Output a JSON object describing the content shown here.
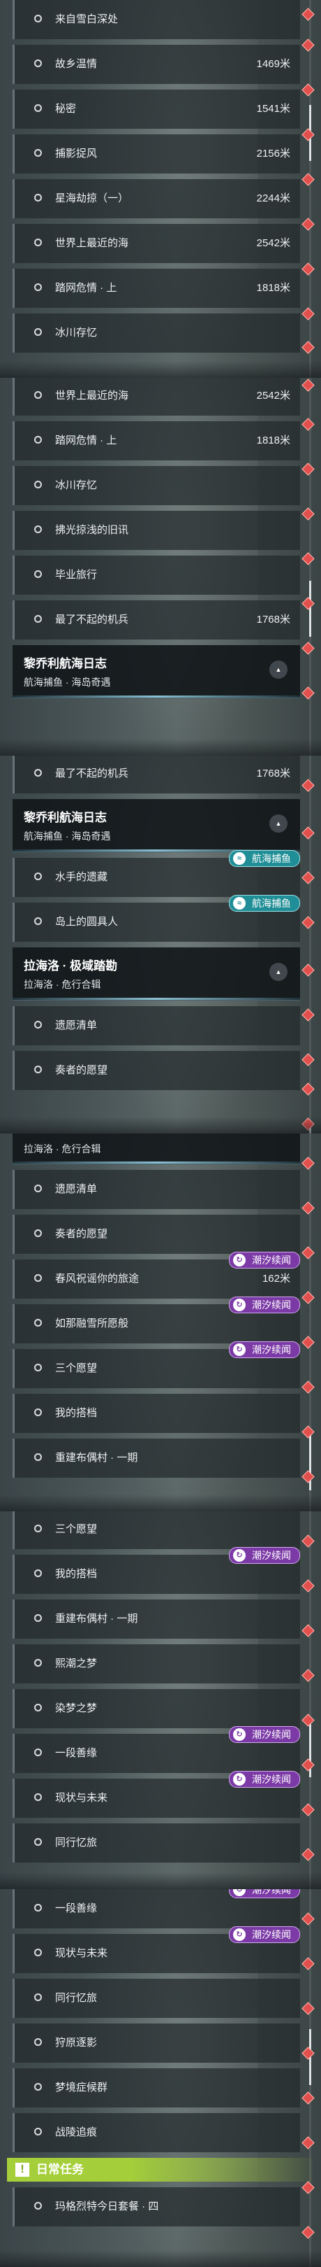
{
  "tags": {
    "chaoxi": "潮汐续闻",
    "hanghai": "航海捕鱼",
    "chaoxi_icon": "spiral-icon",
    "hanghai_icon": "fish-icon"
  },
  "colors": {
    "daily_header": "#a5cf3a",
    "purple_tag": "#7b3aa6",
    "teal_tag": "#1f8e96",
    "marker": "#e2504e"
  },
  "frames": [
    {
      "items": [
        {
          "type": "row",
          "name": "来自雪白深处",
          "dist": ""
        },
        {
          "type": "row",
          "name": "故乡温情",
          "dist": "1469米"
        },
        {
          "type": "row",
          "name": "秘密",
          "dist": "1541米"
        },
        {
          "type": "row",
          "name": "捕影捉风",
          "dist": "2156米"
        },
        {
          "type": "row",
          "name": "星海劫掠（一）",
          "dist": "2244米"
        },
        {
          "type": "row",
          "name": "世界上最近的海",
          "dist": "2542米"
        },
        {
          "type": "row",
          "name": "踏网危情 · 上",
          "dist": "1818米"
        },
        {
          "type": "row",
          "name": "冰川存忆",
          "dist": ""
        }
      ]
    },
    {
      "items": [
        {
          "type": "row",
          "name": "世界上最近的海",
          "dist": "2542米"
        },
        {
          "type": "row",
          "name": "踏网危情 · 上",
          "dist": "1818米"
        },
        {
          "type": "row",
          "name": "冰川存忆",
          "dist": ""
        },
        {
          "type": "row",
          "name": "拂光掠浅的旧讯",
          "dist": ""
        },
        {
          "type": "row",
          "name": "毕业旅行",
          "dist": ""
        },
        {
          "type": "row",
          "name": "最了不起的机兵",
          "dist": "1768米"
        },
        {
          "type": "header",
          "title": "黎乔利航海日志",
          "sub": "航海捕鱼 · 海岛奇遇"
        }
      ]
    },
    {
      "items": [
        {
          "type": "row",
          "name": "最了不起的机兵",
          "dist": "1768米"
        },
        {
          "type": "header",
          "title": "黎乔利航海日志",
          "sub": "航海捕鱼 · 海岛奇遇"
        },
        {
          "type": "row",
          "name": "水手的遗藏",
          "dist": "",
          "tag": "hanghai"
        },
        {
          "type": "row",
          "name": "岛上的圆具人",
          "dist": "",
          "tag": "hanghai"
        },
        {
          "type": "header",
          "title": "拉海洛 · 极域踏勘",
          "sub": "拉海洛 · 危行合辑"
        },
        {
          "type": "row",
          "name": "遗愿清单",
          "dist": ""
        },
        {
          "type": "row",
          "name": "奏者的愿望",
          "dist": ""
        }
      ]
    },
    {
      "items": [
        {
          "type": "header",
          "title": "",
          "sub": "拉海洛 · 危行合辑"
        },
        {
          "type": "row",
          "name": "遗愿清单",
          "dist": ""
        },
        {
          "type": "row",
          "name": "奏者的愿望",
          "dist": ""
        },
        {
          "type": "row",
          "name": "春风祝谣你的旅途",
          "dist": "162米",
          "tag": "chaoxi"
        },
        {
          "type": "row",
          "name": "如那融雪所愿般",
          "dist": "",
          "tag": "chaoxi"
        },
        {
          "type": "row",
          "name": "三个愿望",
          "dist": "",
          "tag": "chaoxi"
        },
        {
          "type": "row",
          "name": "我的搭档",
          "dist": ""
        },
        {
          "type": "row",
          "name": "重建布偶村 · 一期",
          "dist": ""
        }
      ]
    },
    {
      "items": [
        {
          "type": "row",
          "name": "三个愿望",
          "dist": ""
        },
        {
          "type": "row",
          "name": "我的搭档",
          "dist": "",
          "tag": "chaoxi"
        },
        {
          "type": "row",
          "name": "重建布偶村 · 一期",
          "dist": ""
        },
        {
          "type": "row",
          "name": "熙潮之梦",
          "dist": ""
        },
        {
          "type": "row",
          "name": "染梦之梦",
          "dist": ""
        },
        {
          "type": "row",
          "name": "一段善缘",
          "dist": "",
          "tag": "chaoxi"
        },
        {
          "type": "row",
          "name": "现状与未来",
          "dist": "",
          "tag": "chaoxi"
        },
        {
          "type": "row",
          "name": "同行忆旅",
          "dist": ""
        }
      ]
    },
    {
      "items": [
        {
          "type": "row",
          "name": "一段善缘",
          "dist": "",
          "tag": "chaoxi"
        },
        {
          "type": "row",
          "name": "现状与未来",
          "dist": "",
          "tag": "chaoxi"
        },
        {
          "type": "row",
          "name": "同行忆旅",
          "dist": ""
        },
        {
          "type": "row",
          "name": "狩原逐影",
          "dist": ""
        },
        {
          "type": "row",
          "name": "梦境症候群",
          "dist": ""
        },
        {
          "type": "row",
          "name": "战陵追痕",
          "dist": ""
        },
        {
          "type": "daily",
          "title": "日常任务"
        },
        {
          "type": "row",
          "name": "玛格烈特今日套餐 · 四",
          "dist": ""
        }
      ]
    }
  ]
}
